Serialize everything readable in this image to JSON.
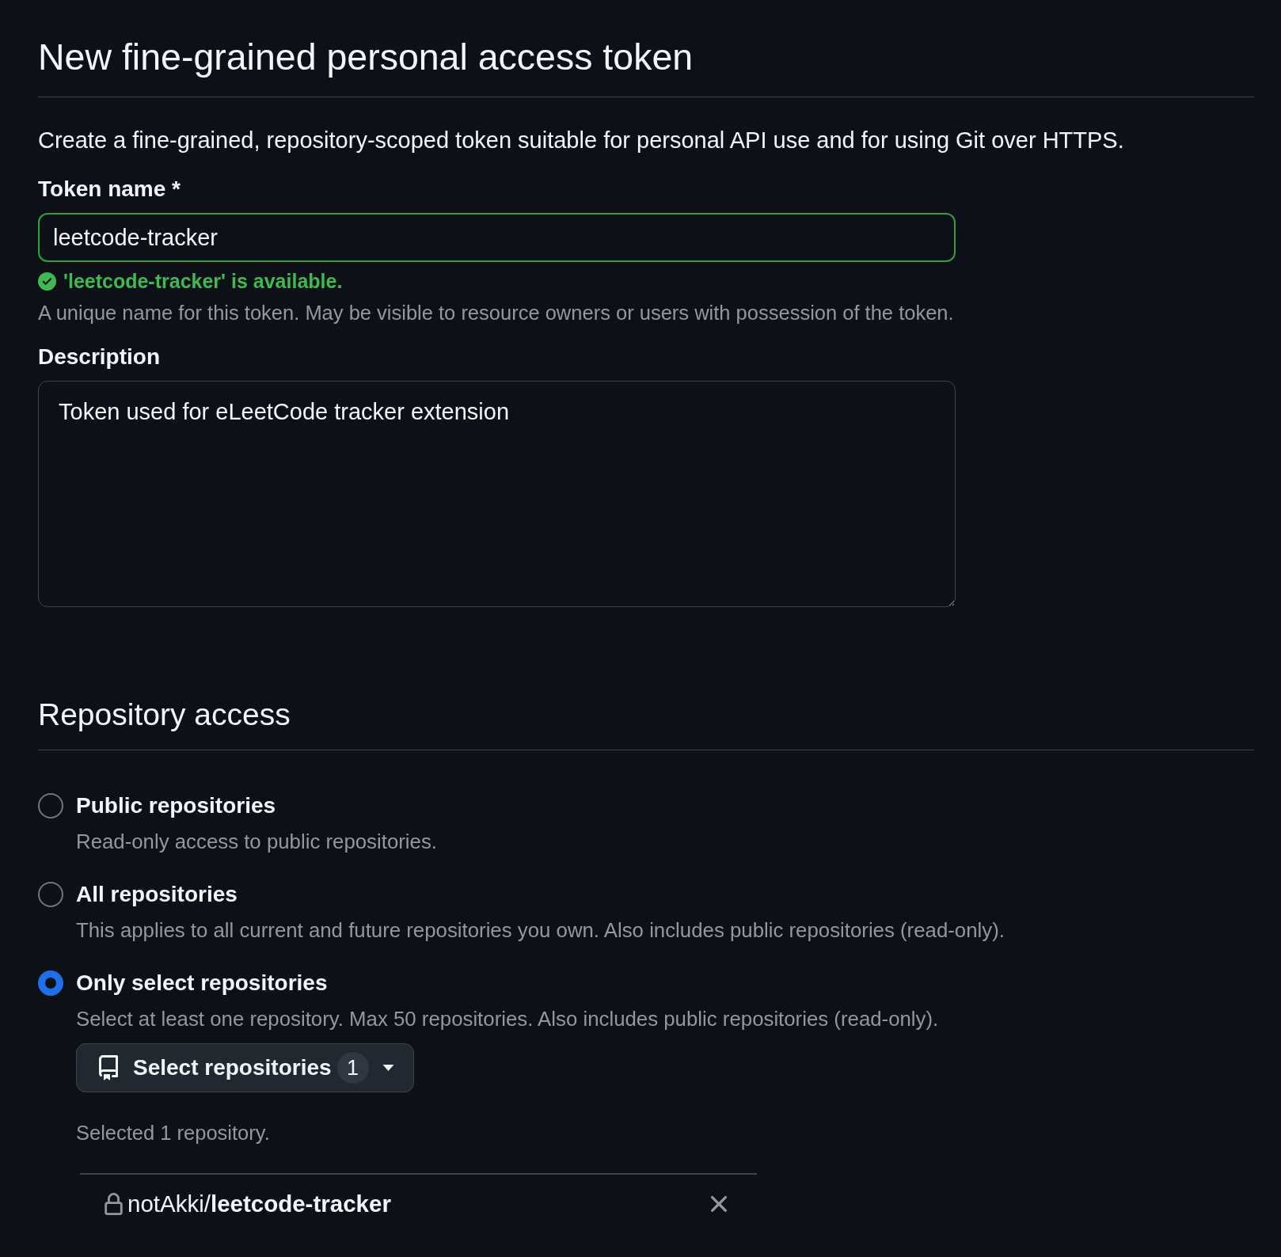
{
  "page": {
    "title": "New fine-grained personal access token",
    "intro": "Create a fine-grained, repository-scoped token suitable for personal API use and for using Git over HTTPS."
  },
  "token_name": {
    "label": "Token name *",
    "value": "leetcode-tracker",
    "valid": true,
    "validation": "'leetcode-tracker' is available.",
    "hint": "A unique name for this token. May be visible to resource owners or users with possession of the token."
  },
  "description": {
    "label": "Description",
    "value": "Token used for eLeetCode tracker extension"
  },
  "repository_access": {
    "heading": "Repository access",
    "options": [
      {
        "label": "Public repositories",
        "description": "Read-only access to public repositories.",
        "selected": false
      },
      {
        "label": "All repositories",
        "description": "This applies to all current and future repositories you own. Also includes public repositories (read-only).",
        "selected": false
      },
      {
        "label": "Only select repositories",
        "description": "Select at least one repository. Max 50 repositories. Also includes public repositories (read-only).",
        "selected": true,
        "select_button": {
          "label": "Select repositories",
          "count": "1"
        },
        "summary": "Selected 1 repository.",
        "repositories": [
          {
            "name": "notAkki/**leetcode-tracker**",
            "private": true
          }
        ]
      }
    ]
  }
}
